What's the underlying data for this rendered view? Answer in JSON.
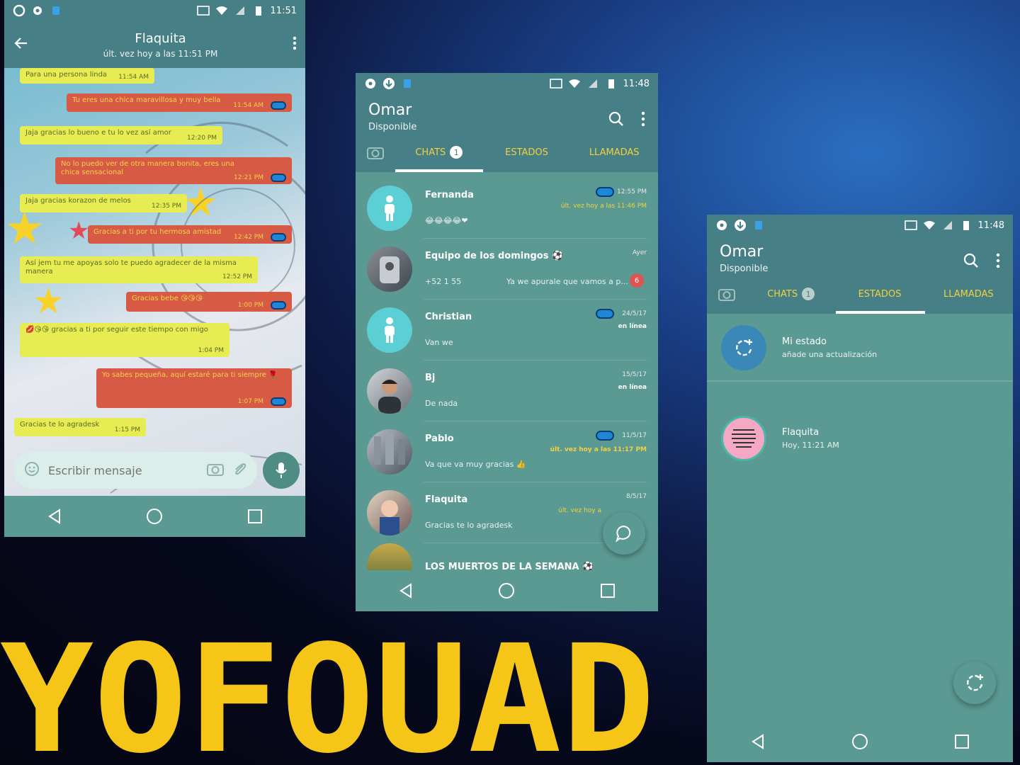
{
  "status": {
    "time_left": "11:51",
    "time_mid": "11:48",
    "time_right": "11:48"
  },
  "chat": {
    "contact": "Flaquita",
    "last_seen": "últ. vez hoy a las 11:51 PM",
    "input_placeholder": "Escribir mensaje",
    "messages": [
      {
        "dir": "in",
        "text": "Para una persona linda",
        "time": "11:54 AM"
      },
      {
        "dir": "out",
        "text": "Tu eres una chica maravillosa y muy bella",
        "time": "11:54 AM"
      },
      {
        "dir": "in",
        "text": "Jaja gracias lo bueno e tu lo vez así amor",
        "time": "12:20 PM"
      },
      {
        "dir": "out",
        "text": "No lo puedo ver de otra manera bonita, eres una chica sensacional",
        "time": "12:21 PM"
      },
      {
        "dir": "in",
        "text": "Jaja gracias korazon de melos",
        "time": "12:35 PM"
      },
      {
        "dir": "out",
        "text": "Gracias a ti por tu hermosa amistad",
        "time": "12:42 PM"
      },
      {
        "dir": "in",
        "text": "Así jem tu me apoyas solo te puedo agradecer de la misma manera",
        "time": "12:52 PM"
      },
      {
        "dir": "out",
        "text": "Gracias bebe 😘😘😘",
        "time": "1:00 PM"
      },
      {
        "dir": "in",
        "text": "💋😘😘 gracias a ti por seguir este tiempo con migo",
        "time": "1:04 PM"
      },
      {
        "dir": "out",
        "text": "Yo sabes pequeña, aquí estaré para ti siempre 🌹",
        "time": "1:07 PM"
      },
      {
        "dir": "in",
        "text": "Gracias te lo agradesk",
        "time": "1:15 PM"
      }
    ]
  },
  "main": {
    "profile_name": "Omar",
    "profile_status": "Disponible",
    "tabs": {
      "chats": "CHATS",
      "chats_badge": "1",
      "estados": "ESTADOS",
      "llamadas": "LLAMADAS"
    },
    "chats": [
      {
        "name": "Fernanda",
        "msg": "😂😂😂😂❤",
        "time": "12:55 PM",
        "status": "últ. vez hoy a las 11:46 PM"
      },
      {
        "name": "Equipo de los domingos ⚽",
        "msg": "+52 1 55",
        "time": "Ayer",
        "preview": "Ya we apurale que vamos a p...",
        "unread": "6"
      },
      {
        "name": "Christian",
        "msg": "Van we",
        "time": "24/5/17",
        "online": "en línea"
      },
      {
        "name": "Bj",
        "msg": "De nada",
        "time": "15/5/17",
        "online": "en línea"
      },
      {
        "name": "Pablo",
        "msg": "Va que va muy gracias 👍",
        "time": "11/5/17",
        "status": "últ. vez hoy a las 11:17 PM"
      },
      {
        "name": "Flaquita",
        "msg": "Gracias te lo agradesk",
        "time": "8/5/17",
        "status": "últ. vez hoy a"
      },
      {
        "name": "LOS MUERTOS DE LA SEMANA ⚽",
        "msg": "",
        "time": ""
      }
    ]
  },
  "states": {
    "my_status_title": "Mi estado",
    "my_status_sub": "añade una actualización",
    "items": [
      {
        "name": "Flaquita",
        "time": "Hoy, 11:21 AM"
      }
    ]
  },
  "brand": {
    "title": "YOFOUAD",
    "color": "#f5c518"
  },
  "colors": {
    "appbar": "#467f86",
    "background": "#5b9a92",
    "accent": "#f3d13e",
    "bubble_in": "#e6ec52",
    "bubble_out": "#d65a44"
  }
}
